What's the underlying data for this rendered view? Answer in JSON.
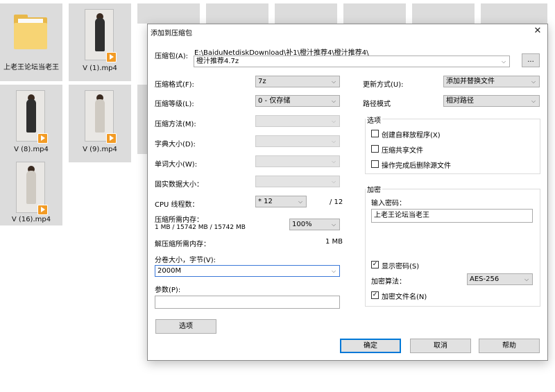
{
  "explorer": {
    "items": [
      {
        "name": "上老王论坛当老王",
        "type": "folder"
      },
      {
        "name": "V (1).mp4",
        "type": "video"
      },
      {
        "name": "V (8).mp4",
        "type": "video"
      },
      {
        "name": "V (9).mp4",
        "type": "video"
      },
      {
        "name": "V (16).mp4",
        "type": "video"
      }
    ]
  },
  "dialog": {
    "title": "添加到压缩包",
    "close_symbol": "✕",
    "archive_label": "压缩包(A):",
    "archive_path": "E:\\BaiduNetdiskDownload\\补1\\橙汁推荐4\\橙汁推荐4\\",
    "archive_name": "橙汁推荐4.7z",
    "browse_label": "...",
    "format_label": "压缩格式(F):",
    "format_value": "7z",
    "level_label": "压缩等级(L):",
    "level_value": "0 - 仅存储",
    "method_label": "压缩方法(M):",
    "dict_label": "字典大小(D):",
    "word_label": "单词大小(W):",
    "solid_label": "固实数据大小：",
    "cpu_label": "CPU 线程数：",
    "cpu_value": "* 12",
    "cpu_total": "/ 12",
    "mem_label": "压缩所需内存：",
    "mem_detail": "1 MB / 15742 MB / 15742 MB",
    "mem_value": "100%",
    "decomp_label": "解压缩所需内存：",
    "decomp_value": "1 MB",
    "volume_label": "分卷大小，字节(V):",
    "volume_value": "2000M",
    "params_label": "参数(P):",
    "params_value": "",
    "options_button": "选项",
    "update_label": "更新方式(U):",
    "update_value": "添加并替换文件",
    "path_label": "路径模式",
    "path_value": "相对路径",
    "options_group": "选项",
    "sfx_label": "创建自释放程序(X)",
    "shared_label": "压缩共享文件",
    "delete_label": "操作完成后删除源文件",
    "encrypt_group": "加密",
    "password_label": "输入密码：",
    "password_value": "上老王论坛当老王",
    "show_password_label": "显示密码(S)",
    "algo_label": "加密算法：",
    "algo_value": "AES-256",
    "encrypt_names_label": "加密文件名(N)",
    "ok_button": "确定",
    "cancel_button": "取消",
    "help_button": "帮助",
    "check_mark": "✓",
    "arrow": "⌵"
  }
}
